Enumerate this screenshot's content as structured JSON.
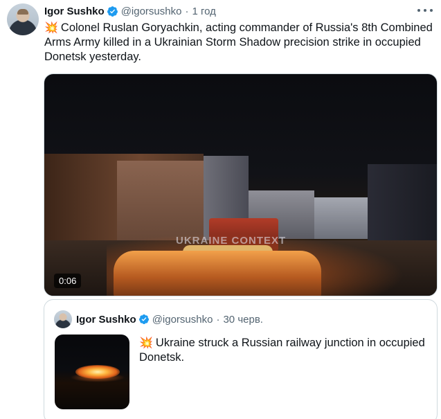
{
  "tweet": {
    "author_name": "Igor Sushko",
    "handle": "@igorsushko",
    "separator": "·",
    "time": "1 год",
    "emoji": "💥",
    "text": "Colonel Ruslan Goryachkin, acting commander of Russia's 8th Combined Arms Army killed in a Ukrainian Storm Shadow precision strike in occupied Donetsk yesterday.",
    "video": {
      "watermark": "UKRAINE CONTEXT",
      "duration": "0:06"
    }
  },
  "quoted_tweet": {
    "author_name": "Igor Sushko",
    "handle": "@igorsushko",
    "separator": "·",
    "time": "30 черв.",
    "emoji": "💥",
    "text": "Ukraine struck a Russian railway junction in occupied Donetsk."
  },
  "colors": {
    "verified": "#1d9bf0",
    "secondary_text": "#536471",
    "border": "#cfd9de"
  },
  "icons": {
    "verified": "verified-badge-icon",
    "more": "more-dots-icon",
    "emoji": "collision-emoji-icon"
  }
}
